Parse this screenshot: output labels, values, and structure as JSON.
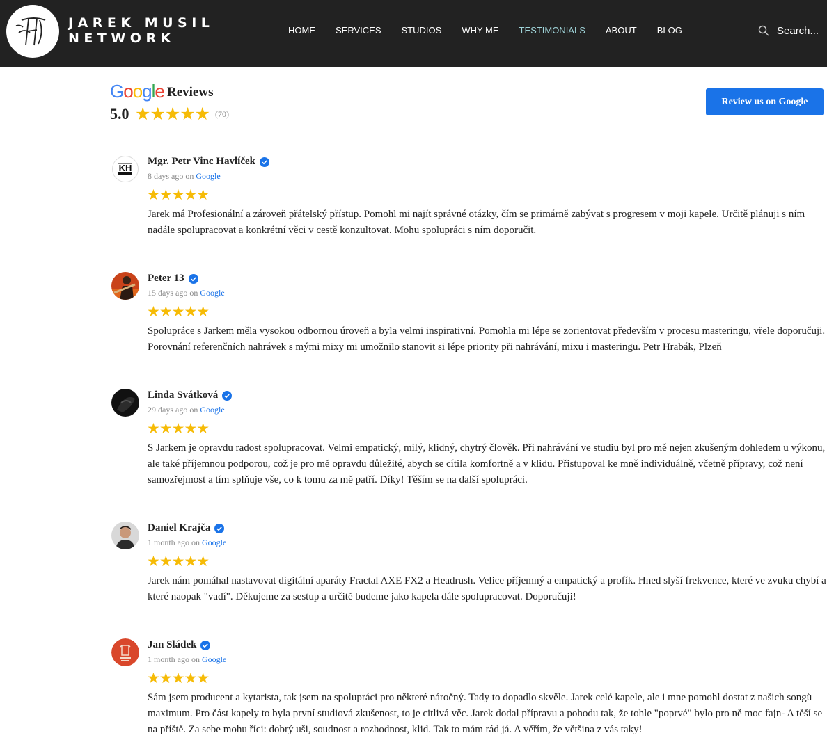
{
  "header": {
    "brand_line1": "JAREK MUSIL",
    "brand_line2": "NETWORK",
    "nav": [
      {
        "label": "HOME",
        "active": false
      },
      {
        "label": "SERVICES",
        "active": false
      },
      {
        "label": "STUDIOS",
        "active": false
      },
      {
        "label": "WHY ME",
        "active": false
      },
      {
        "label": "TESTIMONIALS",
        "active": true
      },
      {
        "label": "ABOUT",
        "active": false
      },
      {
        "label": "BLOG",
        "active": false
      }
    ],
    "search_label": "Search...",
    "active_color": "#9fd3d8",
    "background": "#222222"
  },
  "summary": {
    "google": [
      "G",
      "o",
      "o",
      "g",
      "l",
      "e"
    ],
    "title": "Reviews",
    "rating": "5.0",
    "stars": "★★★★★",
    "count": "(70)",
    "button_label": "Review us on Google",
    "star_color": "#f6bb06",
    "button_color": "#1a73e8"
  },
  "reviews": [
    {
      "author": "Mgr. Petr Vinc Havlíček",
      "time": "8 days ago",
      "on": "on",
      "source": "Google",
      "stars": "★★★★★",
      "avatar": "kh-filmin-logo",
      "text": "Jarek má Profesionální a zároveň přátelský přístup. Pomohl mi najít správné otázky, čím se primárně zabývat s progresem v moji kapele. Určitě plánuji s ním nadále spolupracovat a konkrétní věci v cestě konzultovat. Mohu spolupráci s ním doporučit."
    },
    {
      "author": "Peter 13",
      "time": "15 days ago",
      "on": "on",
      "source": "Google",
      "stars": "★★★★★",
      "avatar": "guitarist-photo",
      "text": "Spolupráce s Jarkem měla vysokou odbornou úroveň a byla velmi inspirativní. Pomohla mi lépe se zorientovat především v procesu masteringu, vřele doporučuji. Porovnání referenčních nahrávek s mými mixy mi umožnilo stanovit si lépe priority při nahrávání, mixu i masteringu. Petr Hrabák, Plzeň"
    },
    {
      "author": "Linda Svátková",
      "time": "29 days ago",
      "on": "on",
      "source": "Google",
      "stars": "★★★★★",
      "avatar": "dark-portrait",
      "text": "S Jarkem je opravdu radost spolupracovat. Velmi empatický, milý, klidný, chytrý člověk. Při nahrávání ve studiu byl pro mě nejen zkušeným dohledem u výkonu, ale také příjemnou podporou, což je pro mě opravdu důležité, abych se cítila komfortně a v klidu. Přistupoval ke mně individuálně, včetně přípravy, což není samozřejmost a tím splňuje vše, co k tomu za mě patří. Díky! Těším se na další spolupráci."
    },
    {
      "author": "Daniel Krajča",
      "time": "1 month ago",
      "on": "on",
      "source": "Google",
      "stars": "★★★★★",
      "avatar": "man-portrait",
      "text": "Jarek nám pomáhal nastavovat digitální aparáty Fractal AXE FX2 a Headrush. Velice příjemný a empatický a profík. Hned slyší frekvence, které ve zvuku chybí a které naopak \"vadí\". Děkujeme za sestup a určitě budeme jako kapela dále spolupracovat. Doporučuji!"
    },
    {
      "author": "Jan Sládek",
      "time": "1 month ago",
      "on": "on",
      "source": "Google",
      "stars": "★★★★★",
      "avatar": "red-music-logo",
      "text": "Sám jsem producent a kytarista, tak jsem na spolupráci pro některé náročný. Tady to dopadlo skvěle. Jarek celé kapele, ale i mne pomohl dostat z našich songů maximum. Pro část kapely to byla první studiová zkušenost, to je citlivá věc. Jarek dodal přípravu a pohodu tak, že tohle \"poprvé\" bylo pro ně moc fajn- A těší se na příště. Za sebe mohu říci: dobrý uši, soudnost a rozhodnost, klid. Tak to mám rád já. A věřím, že většina z vás taky!"
    }
  ]
}
